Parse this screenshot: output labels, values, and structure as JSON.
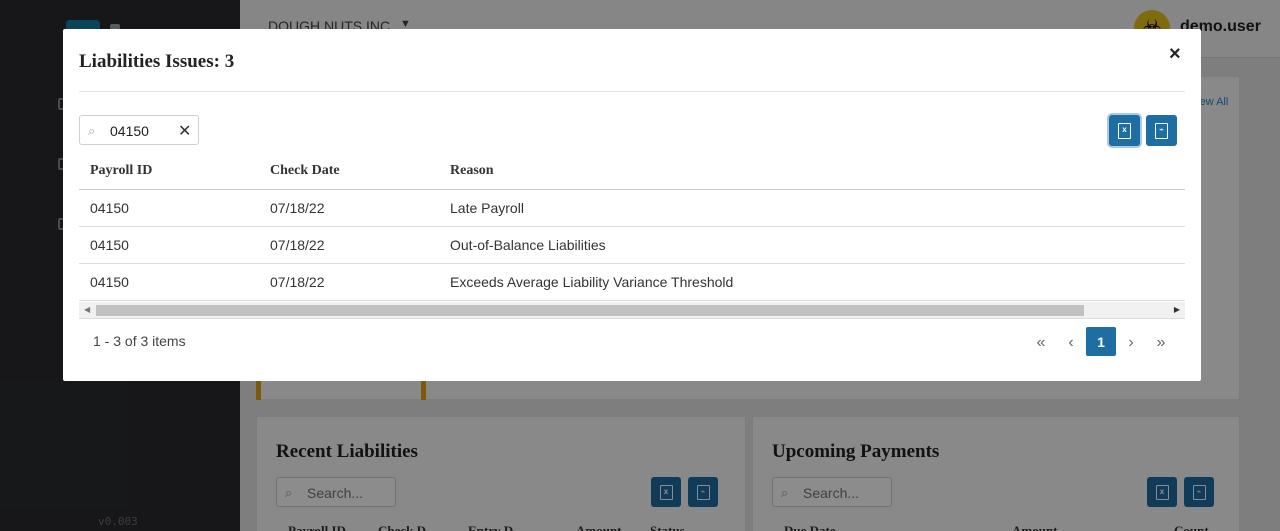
{
  "app": {
    "company": "DOUGH NUTS INC",
    "username": "demo.user",
    "version": "v0.003",
    "view_all": "View All"
  },
  "background_cards": {
    "recent_liabilities": {
      "title": "Recent Liabilities",
      "search_placeholder": "Search...",
      "columns": [
        "Payroll ID",
        "Check D",
        "Entry D",
        "Amount",
        "Status"
      ]
    },
    "upcoming_payments": {
      "title": "Upcoming Payments",
      "search_placeholder": "Search...",
      "columns": [
        "Due Date",
        "Amount",
        "Count"
      ]
    }
  },
  "modal": {
    "title": "Liabilities Issues: 3",
    "close_glyph": "×",
    "search_value": "04150",
    "clear_glyph": "✕",
    "columns": [
      "Payroll ID",
      "Check Date",
      "Reason"
    ],
    "rows": [
      {
        "payroll_id": "04150",
        "check_date": "07/18/22",
        "reason": "Late Payroll"
      },
      {
        "payroll_id": "04150",
        "check_date": "07/18/22",
        "reason": "Out-of-Balance Liabilities"
      },
      {
        "payroll_id": "04150",
        "check_date": "07/18/22",
        "reason": "Exceeds Average Liability Variance Threshold"
      }
    ],
    "pager": {
      "info": "1 - 3 of 3 items",
      "current_page": "1"
    },
    "icons": {
      "search": "search-icon",
      "excel": "file-excel-icon",
      "pdf": "file-pdf-icon"
    },
    "colors": {
      "primary": "#1f6ea3"
    }
  }
}
